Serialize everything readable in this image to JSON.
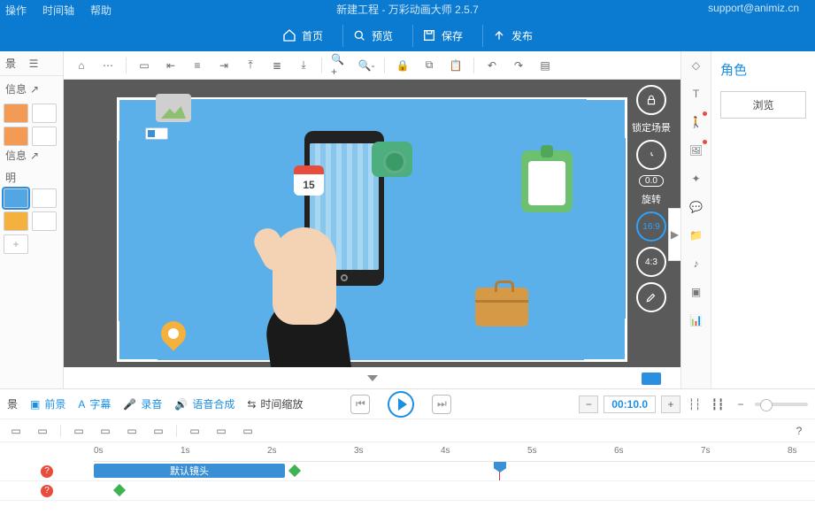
{
  "header": {
    "menu": [
      "操作",
      "时间轴",
      "帮助"
    ],
    "title": "新建工程 - 万彩动画大师 2.5.7",
    "support": "support@animiz.cn",
    "main_buttons": [
      {
        "label": "首页"
      },
      {
        "label": "预览"
      },
      {
        "label": "保存"
      },
      {
        "label": "发布"
      }
    ]
  },
  "left": {
    "tab": "景",
    "groups": [
      {
        "label": "信息"
      },
      {
        "label": "信息"
      },
      {
        "label": "明"
      }
    ]
  },
  "canvas": {
    "calendar_day": "15",
    "right": {
      "lock": "锁定场景",
      "rotation_value": "0.0",
      "rotate": "旋转",
      "ratio1": "16:9",
      "ratio2": "4:3"
    }
  },
  "rightpanel": {
    "title": "角色",
    "browse": "浏览"
  },
  "tlbar": {
    "items": [
      "景",
      "前景",
      "字幕",
      "录音",
      "语音合成",
      "时间缩放"
    ],
    "time": "00:10.0"
  },
  "timeline": {
    "ticks": [
      "0s",
      "1s",
      "2s",
      "3s",
      "4s",
      "5s",
      "6s",
      "7s",
      "8s"
    ],
    "clip_label": "默认镜头",
    "playhead_sec": 5
  },
  "chart_data": null
}
